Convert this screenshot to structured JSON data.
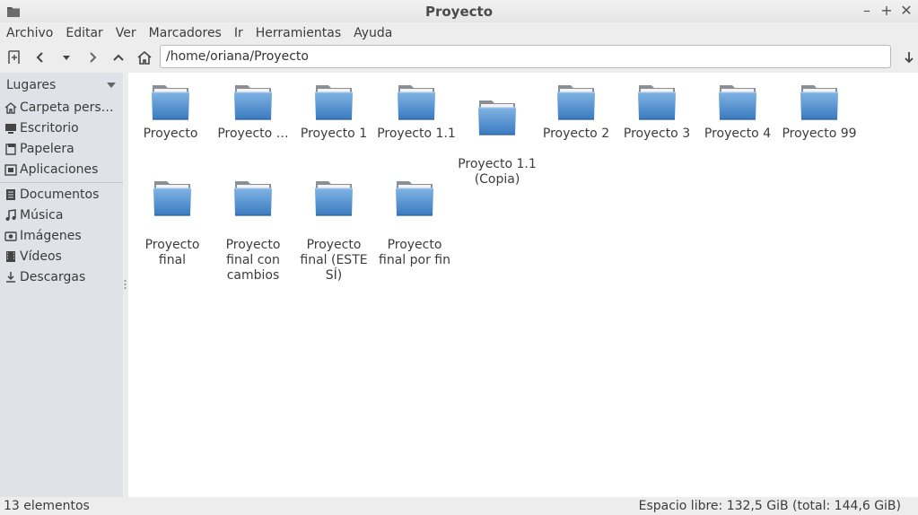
{
  "window": {
    "title": "Proyecto"
  },
  "menu": [
    "Archivo",
    "Editar",
    "Ver",
    "Marcadores",
    "Ir",
    "Herramientas",
    "Ayuda"
  ],
  "location": {
    "path": "/home/oriana/Proyecto"
  },
  "sidebar": {
    "header": "Lugares",
    "places": [
      {
        "label": "Carpeta pers…",
        "icon": "home-icon"
      },
      {
        "label": "Escritorio",
        "icon": "desktop-icon"
      },
      {
        "label": "Papelera",
        "icon": "trash-icon"
      },
      {
        "label": "Aplicaciones",
        "icon": "applications-icon"
      }
    ],
    "bookmarks": [
      {
        "label": "Documentos",
        "icon": "documents-icon"
      },
      {
        "label": "Música",
        "icon": "music-icon"
      },
      {
        "label": "Imágenes",
        "icon": "pictures-icon"
      },
      {
        "label": "Vídeos",
        "icon": "videos-icon"
      },
      {
        "label": "Descargas",
        "icon": "downloads-icon"
      }
    ]
  },
  "files": [
    {
      "name": "Proyecto"
    },
    {
      "name": "Proyecto …"
    },
    {
      "name": "Proyecto 1"
    },
    {
      "name": "Proyecto 1.1"
    },
    {
      "name": "Proyecto 1.1\n(Copia)"
    },
    {
      "name": "Proyecto 2"
    },
    {
      "name": "Proyecto 3"
    },
    {
      "name": "Proyecto 4"
    },
    {
      "name": "Proyecto 99"
    },
    {
      "name": "Proyecto\nfinal"
    },
    {
      "name": "Proyecto\nfinal con\ncambios"
    },
    {
      "name": "Proyecto\nfinal (ESTE\nSÍ)"
    },
    {
      "name": "Proyecto\nfinal por fin"
    }
  ],
  "status": {
    "count": "13 elementos",
    "free_space": "Espacio libre: 132,5 GiB (total: 144,6 GiB)"
  },
  "colors": {
    "folder": "#4f8fc9",
    "sidebar": "#dfe3e7"
  }
}
